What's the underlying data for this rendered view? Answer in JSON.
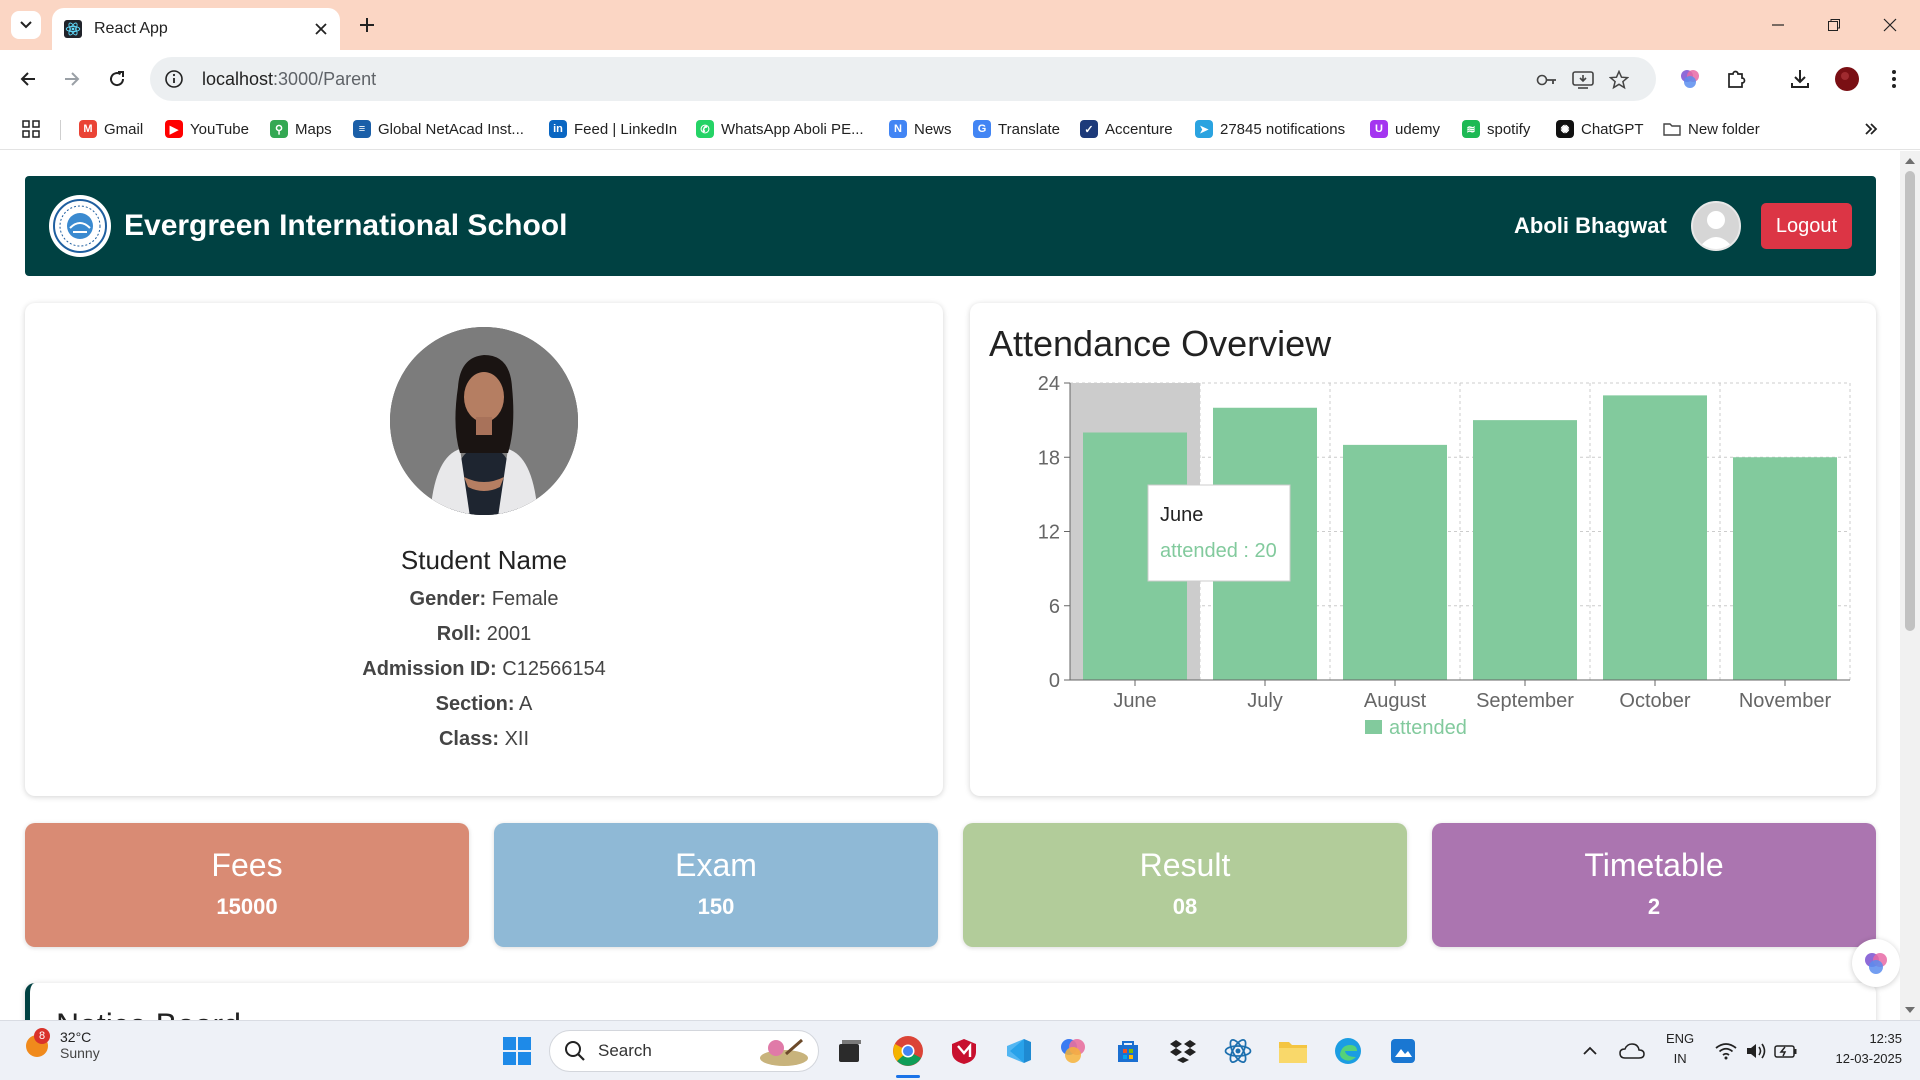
{
  "browser": {
    "tab_title": "React App",
    "url_host": "localhost",
    "url_rest": ":3000/Parent",
    "bookmarks": [
      {
        "label": "Gmail",
        "color": "#ea4335",
        "glyph": "M"
      },
      {
        "label": "YouTube",
        "color": "#ff0000",
        "glyph": "▶"
      },
      {
        "label": "Maps",
        "color": "#34a853",
        "glyph": "⚲"
      },
      {
        "label": "Global NetAcad Inst...",
        "color": "#1b5fa8",
        "glyph": "≡"
      },
      {
        "label": "Feed | LinkedIn",
        "color": "#0a66c2",
        "glyph": "in"
      },
      {
        "label": "WhatsApp Aboli PE...",
        "color": "#25d366",
        "glyph": "✆"
      },
      {
        "label": "News",
        "color": "#4285f4",
        "glyph": "N"
      },
      {
        "label": "Translate",
        "color": "#4285f4",
        "glyph": "G"
      },
      {
        "label": "Accenture",
        "color": "#1d3a7a",
        "glyph": "✓"
      },
      {
        "label": "27845 notifications",
        "color": "#2aa3e0",
        "glyph": "➤"
      },
      {
        "label": "udemy",
        "color": "#a435f0",
        "glyph": "U"
      },
      {
        "label": "spotify",
        "color": "#1db954",
        "glyph": "≋"
      },
      {
        "label": "ChatGPT",
        "color": "#111111",
        "glyph": "✺"
      },
      {
        "label": "New folder",
        "color": "#ffffff",
        "glyph": ""
      }
    ]
  },
  "header": {
    "school_name": "Evergreen International School",
    "user_name": "Aboli Bhagwat",
    "logout_label": "Logout"
  },
  "student": {
    "name": "Student Name",
    "gender_label": "Gender:",
    "gender": "Female",
    "roll_label": "Roll:",
    "roll": "2001",
    "admission_label": "Admission ID:",
    "admission": "C12566154",
    "section_label": "Section:",
    "section": "A",
    "class_label": "Class:",
    "class": "XII"
  },
  "chart_data": {
    "type": "bar",
    "title": "Attendance Overview",
    "categories": [
      "June",
      "July",
      "August",
      "September",
      "October",
      "November"
    ],
    "series": [
      {
        "name": "attended",
        "values": [
          20,
          22,
          19,
          21,
          23,
          18
        ]
      }
    ],
    "ylim": [
      0,
      24
    ],
    "yticks": [
      0,
      6,
      12,
      18,
      24
    ],
    "grid": true,
    "legend": "bottom",
    "color": "#82ca9d",
    "tooltip": {
      "category": "June",
      "series": "attended",
      "value": 20
    }
  },
  "stats": [
    {
      "label": "Fees",
      "value": "15000",
      "color": "#d98b74"
    },
    {
      "label": "Exam",
      "value": "150",
      "color": "#8fb9d6"
    },
    {
      "label": "Result",
      "value": "08",
      "color": "#b2cc9a"
    },
    {
      "label": "Timetable",
      "value": "2",
      "color": "#ab75b0"
    }
  ],
  "notice": {
    "title": "Notice Board"
  },
  "taskbar": {
    "weather_temp": "32°C",
    "weather_cond": "Sunny",
    "weather_badge": "8",
    "search_label": "Search",
    "lang_1": "ENG",
    "lang_2": "IN",
    "time": "12:35",
    "date": "12-03-2025"
  }
}
